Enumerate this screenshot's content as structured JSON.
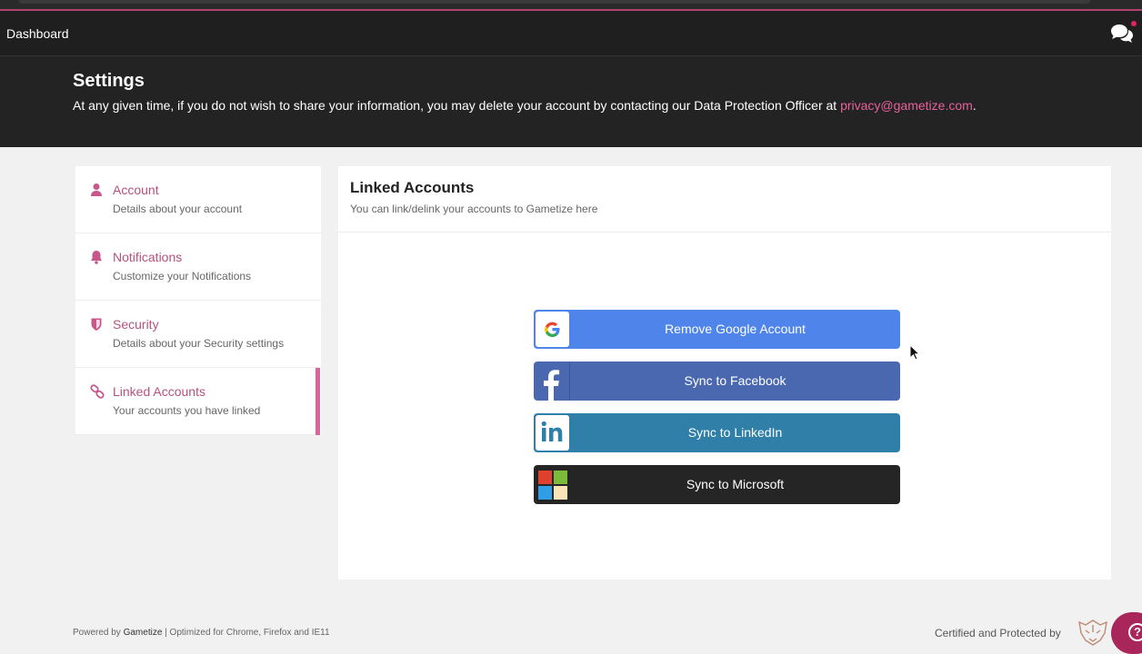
{
  "navbar": {
    "brand": "Dashboard",
    "chat_icon": "chat-bubbles-icon"
  },
  "header": {
    "title": "Settings",
    "message": "At any given time, if you do not wish to share your information, you may delete your account by contacting our Data Protection Officer at ",
    "email": "privacy@gametize.com",
    "message_end": "."
  },
  "sidebar": {
    "items": [
      {
        "title": "Account",
        "subtitle": "Details about your account",
        "icon": "user-icon"
      },
      {
        "title": "Notifications",
        "subtitle": "Customize your Notifications",
        "icon": "bell-icon"
      },
      {
        "title": "Security",
        "subtitle": "Details about your Security settings",
        "icon": "shield-icon"
      },
      {
        "title": "Linked Accounts",
        "subtitle": "Your accounts you have linked",
        "icon": "link-icon",
        "active": true
      }
    ]
  },
  "panel": {
    "title": "Linked Accounts",
    "description": "You can link/delink your accounts to Gametize here",
    "buttons": [
      {
        "label": "Remove Google Account",
        "icon": "google-icon",
        "color": "#4f84ea"
      },
      {
        "label": "Sync to Facebook",
        "icon": "facebook-icon",
        "color": "#4a68b0"
      },
      {
        "label": "Sync to LinkedIn",
        "icon": "linkedin-icon",
        "color": "#2f7fa8"
      },
      {
        "label": "Sync to Microsoft",
        "icon": "microsoft-icon",
        "color": "#252525"
      }
    ]
  },
  "footer": {
    "powered_prefix": "Powered by ",
    "powered_brand": "Gametize",
    "powered_suffix": " | Optimized for Chrome, Firefox and IE11",
    "certified": "Certified and Protected by"
  },
  "colors": {
    "accent": "#b5527e",
    "active_bar": "#d9669a",
    "email_link": "#e8609b",
    "help_button": "#a8265a"
  }
}
